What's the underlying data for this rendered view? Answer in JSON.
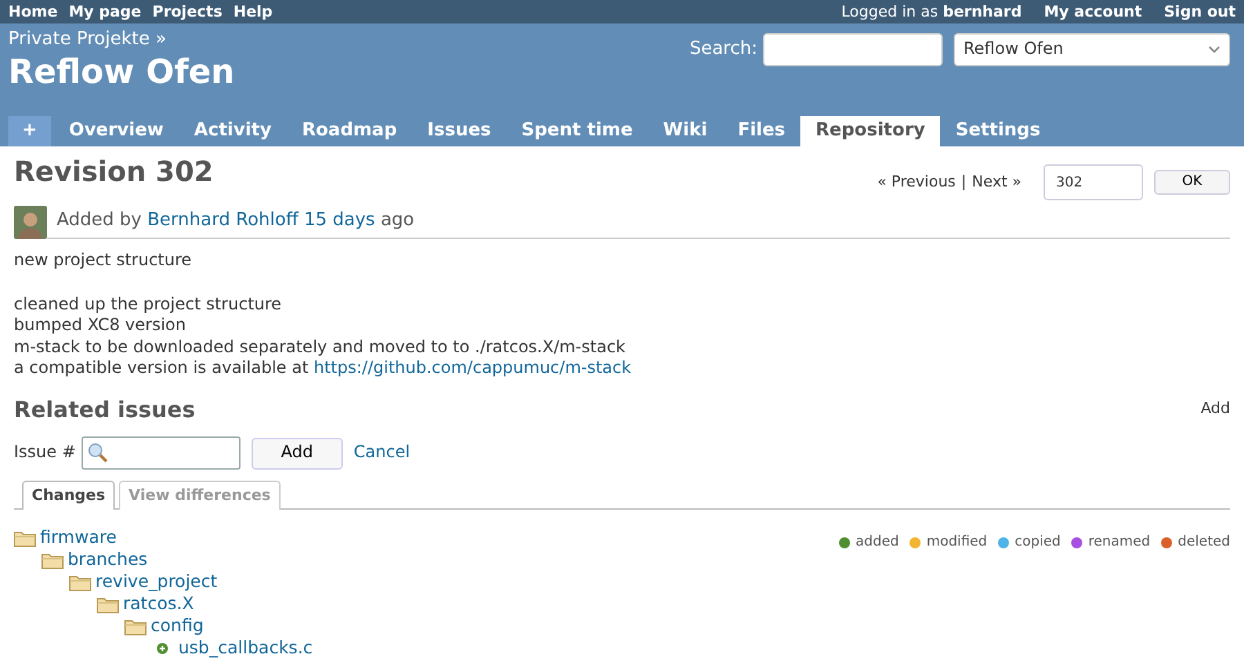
{
  "top_menu": {
    "left": [
      "Home",
      "My page",
      "Projects",
      "Help"
    ],
    "logged_in_prefix": "Logged in as",
    "user": "bernhard",
    "right": [
      "My account",
      "Sign out"
    ]
  },
  "header": {
    "parent": "Private Projekte »",
    "title": "Reflow Ofen",
    "search_label": "Search:",
    "project_select": "Reflow Ofen"
  },
  "tabs": [
    {
      "label": "+",
      "kind": "new",
      "selected": false
    },
    {
      "label": "Overview",
      "kind": "tab",
      "selected": false
    },
    {
      "label": "Activity",
      "kind": "tab",
      "selected": false
    },
    {
      "label": "Roadmap",
      "kind": "tab",
      "selected": false
    },
    {
      "label": "Issues",
      "kind": "tab",
      "selected": false
    },
    {
      "label": "Spent time",
      "kind": "tab",
      "selected": false
    },
    {
      "label": "Wiki",
      "kind": "tab",
      "selected": false
    },
    {
      "label": "Files",
      "kind": "tab",
      "selected": false
    },
    {
      "label": "Repository",
      "kind": "tab",
      "selected": true
    },
    {
      "label": "Settings",
      "kind": "tab",
      "selected": false
    }
  ],
  "revision": {
    "title": "Revision 302",
    "nav": {
      "previous": "« Previous",
      "separator": "|",
      "next": "Next »",
      "rev_value": "302",
      "ok": "OK"
    },
    "added_by": "Added by",
    "author": "Bernhard Rohloff",
    "age": "15 days",
    "ago": "ago",
    "message": [
      "new project structure"
    ],
    "details": [
      "cleaned up the project structure",
      "bumped XC8 version",
      "m-stack to be downloaded separately and moved to to ./ratcos.X/m-stack"
    ],
    "link_line": {
      "text": "a compatible version is available at",
      "link": "https://github.com/cappumuc/m-stack"
    }
  },
  "related_issues": {
    "title": "Related issues",
    "add_link": "Add",
    "issue_label": "Issue #",
    "add_button": "Add",
    "cancel": "Cancel"
  },
  "change_tabs": [
    {
      "label": "Changes",
      "selected": true
    },
    {
      "label": "View differences",
      "selected": false
    }
  ],
  "legend": [
    {
      "label": "added",
      "color": "#4f8f2f"
    },
    {
      "label": "modified",
      "color": "#f2b531"
    },
    {
      "label": "copied",
      "color": "#4fb3e6"
    },
    {
      "label": "renamed",
      "color": "#a64fe0"
    },
    {
      "label": "deleted",
      "color": "#d9602a"
    }
  ],
  "tree": [
    {
      "kind": "folder",
      "name": "firmware",
      "children": [
        {
          "kind": "folder",
          "name": "branches",
          "children": [
            {
              "kind": "folder",
              "name": "revive_project",
              "children": [
                {
                  "kind": "folder",
                  "name": "ratcos.X",
                  "children": [
                    {
                      "kind": "folder",
                      "name": "config",
                      "children": [
                        {
                          "kind": "file",
                          "name": "usb_callbacks.c",
                          "color": "#4f8f2f"
                        }
                      ]
                    }
                  ]
                }
              ]
            }
          ]
        }
      ]
    }
  ]
}
